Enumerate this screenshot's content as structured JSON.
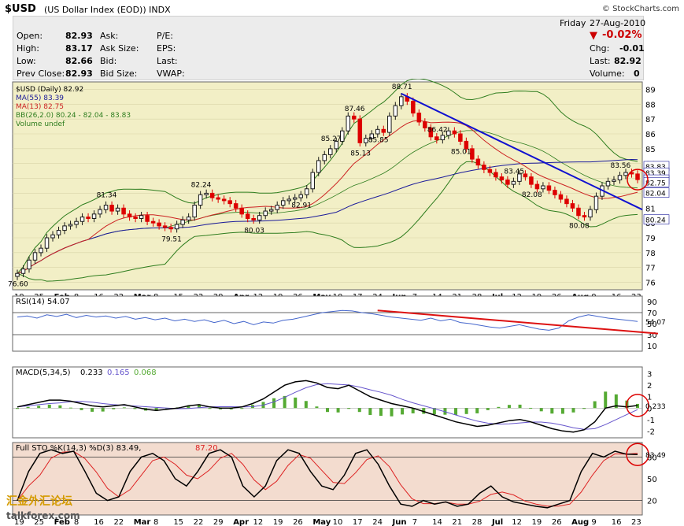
{
  "header": {
    "symbol": "$USD",
    "name": "(US Dollar Index (EOD))",
    "exchange": "INDX",
    "copyright": "© StockCharts.com"
  },
  "quote": {
    "open_label": "Open:",
    "open": "82.93",
    "high_label": "High:",
    "high": "83.17",
    "low_label": "Low:",
    "low": "82.66",
    "prev_label": "Prev Close:",
    "prev": "82.93",
    "ask_label": "Ask:",
    "asksize_label": "Ask Size:",
    "bid_label": "Bid:",
    "bidsize_label": "Bid Size:",
    "pe_label": "P/E:",
    "eps_label": "EPS:",
    "last_label": "Last:",
    "vwap_label": "VWAP:",
    "day": "Friday",
    "date": "27-Aug-2010",
    "pct_change": "-0.02%",
    "chg_label": "Chg:",
    "chg": "-0.01",
    "last2_label": "Last:",
    "last2": "82.92",
    "volume_label": "Volume:",
    "volume": "0"
  },
  "legend": {
    "main": "$USD (Daily) 82.92",
    "ma55": "MA(55) 83.39",
    "ma13": "MA(13) 82.75",
    "bb": "BB(26,2.0) 80.24 - 82.04 - 83.83",
    "volume": "Volume undef",
    "rsi": "RSI(14) 54.07",
    "macd_label": "MACD(5,34,5)",
    "macd_v1": "0.233",
    "macd_v2": "0.165",
    "macd_v3": "0.068",
    "sto_label": "Full STO %K(14,3) %D(3) 83.49,",
    "sto_v2": "87.20"
  },
  "watermark": {
    "cn": "汇金外汇论坛",
    "url": "talkforex.com"
  },
  "colors": {
    "price_bg": "#f2efc6",
    "indicator_bg": "#ffffff",
    "sto_bg": "#f3dccf",
    "up_candle": "#1a1a1a",
    "down_candle": "#dd0000",
    "ma55": "#1a1a9a",
    "ma13": "#cc2222",
    "bb": "#2e7d1e",
    "trend_blue": "#1010d0",
    "trend_red": "#dd1111",
    "rsi_line": "#4466cc",
    "macd_line": "#000000",
    "macd_signal": "#6655cc",
    "macd_hist": "#55aa33",
    "sto_k": "#000000",
    "sto_d": "#dd2222",
    "circle": "#dd0000"
  },
  "chart_data": {
    "type": "line",
    "title": "$USD (US Dollar Index (EOD)) INDX",
    "date_range": [
      "2010-01-19",
      "2010-08-27"
    ],
    "x_tick_labels": [
      "19",
      "25",
      "Feb",
      "8",
      "16",
      "22",
      "Mar",
      "8",
      "15",
      "22",
      "29",
      "Apr",
      "12",
      "19",
      "26",
      "May",
      "10",
      "17",
      "24",
      "Jun",
      "7",
      "14",
      "21",
      "28",
      "Jul",
      "12",
      "19",
      "26",
      "Aug",
      "9",
      "16",
      "23"
    ],
    "y_ticks": [
      76,
      77,
      78,
      79,
      80,
      81,
      82,
      83,
      84,
      85,
      86,
      87,
      88,
      89
    ],
    "ylim": [
      75.5,
      89.5
    ],
    "price_close": [
      76.6,
      76.9,
      77.5,
      78.0,
      78.3,
      79.0,
      79.2,
      79.5,
      79.8,
      79.9,
      80.1,
      80.4,
      80.3,
      80.6,
      80.9,
      81.2,
      80.8,
      81.0,
      80.6,
      80.4,
      80.3,
      80.5,
      80.1,
      80.0,
      79.8,
      79.7,
      79.6,
      79.9,
      80.2,
      80.4,
      81.2,
      81.9,
      82.0,
      81.7,
      81.6,
      81.5,
      81.3,
      81.0,
      80.6,
      80.3,
      80.2,
      80.5,
      80.8,
      80.9,
      81.2,
      81.5,
      81.6,
      81.7,
      81.9,
      82.3,
      83.4,
      84.2,
      84.6,
      85.0,
      85.5,
      86.2,
      87.2,
      87.0,
      85.4,
      85.7,
      86.0,
      86.3,
      86.1,
      87.2,
      87.9,
      88.5,
      88.2,
      87.4,
      86.8,
      86.4,
      85.8,
      85.6,
      85.9,
      86.2,
      86.0,
      85.5,
      85.0,
      84.3,
      83.9,
      83.6,
      83.4,
      83.1,
      82.9,
      82.6,
      82.8,
      83.3,
      83.1,
      82.6,
      82.3,
      82.5,
      82.2,
      81.9,
      81.6,
      81.3,
      81.0,
      80.5,
      80.4,
      80.9,
      81.8,
      82.5,
      82.8,
      82.9,
      83.2,
      83.4,
      83.3,
      82.92
    ],
    "annotations": [
      {
        "label": "76.60",
        "x_index": 0
      },
      {
        "label": "81.34",
        "x_index": 15
      },
      {
        "label": "79.51",
        "x_index": 26
      },
      {
        "label": "82.24",
        "x_index": 31
      },
      {
        "label": "80.03",
        "x_index": 40
      },
      {
        "label": "82.91",
        "x_index": 48
      },
      {
        "label": "85.27",
        "x_index": 53
      },
      {
        "label": "87.46",
        "x_index": 57
      },
      {
        "label": "85.13",
        "x_index": 58
      },
      {
        "label": "85.85",
        "x_index": 61
      },
      {
        "label": "88.71",
        "x_index": 65
      },
      {
        "label": "86.42",
        "x_index": 71
      },
      {
        "label": "85.01",
        "x_index": 75
      },
      {
        "label": "83.45",
        "x_index": 84
      },
      {
        "label": "82.08",
        "x_index": 87
      },
      {
        "label": "80.08",
        "x_index": 95
      },
      {
        "label": "83.56",
        "x_index": 102
      }
    ],
    "right_axis_tags": [
      "83.83",
      "83.39",
      "82.92",
      "82.75",
      "82.04",
      "80.24"
    ],
    "rsi": {
      "ticks": [
        90,
        70,
        50,
        30,
        10
      ],
      "ylim": [
        0,
        100
      ],
      "last": "54.07",
      "values": [
        62,
        64,
        60,
        66,
        63,
        67,
        61,
        65,
        62,
        64,
        60,
        63,
        58,
        61,
        57,
        60,
        55,
        58,
        54,
        57,
        52,
        56,
        50,
        54,
        48,
        53,
        51,
        56,
        58,
        62,
        66,
        70,
        72,
        74,
        73,
        70,
        68,
        65,
        62,
        60,
        58,
        56,
        60,
        55,
        58,
        52,
        50,
        47,
        44,
        42,
        45,
        48,
        44,
        40,
        38,
        42,
        55,
        62,
        66,
        63,
        60,
        58,
        56,
        54.07
      ]
    },
    "macd": {
      "ticks": [
        3,
        2,
        1,
        0,
        -1,
        -2
      ],
      "ylim": [
        -2.6,
        3.6
      ],
      "last": "0.233",
      "values": [
        0.1,
        0.3,
        0.5,
        0.7,
        0.7,
        0.6,
        0.4,
        0.2,
        0.1,
        0.2,
        0.3,
        0.1,
        -0.1,
        -0.2,
        -0.1,
        0.0,
        0.2,
        0.3,
        0.1,
        0.0,
        0.0,
        0.1,
        0.4,
        0.8,
        1.4,
        2.0,
        2.3,
        2.4,
        2.2,
        1.8,
        1.7,
        2.0,
        1.5,
        1.0,
        0.7,
        0.4,
        0.2,
        0.0,
        -0.3,
        -0.6,
        -0.9,
        -1.2,
        -1.4,
        -1.6,
        -1.5,
        -1.3,
        -1.1,
        -1.0,
        -1.2,
        -1.5,
        -1.8,
        -2.0,
        -2.1,
        -1.9,
        -1.2,
        0.0,
        0.2,
        0.1,
        0.233
      ]
    },
    "sto": {
      "ticks": [
        80,
        50,
        20
      ],
      "ylim": [
        0,
        100
      ],
      "last": "83.49",
      "values": [
        20,
        60,
        85,
        90,
        85,
        88,
        60,
        30,
        20,
        25,
        60,
        80,
        85,
        75,
        50,
        40,
        60,
        85,
        90,
        80,
        40,
        25,
        40,
        75,
        90,
        85,
        60,
        40,
        35,
        55,
        85,
        90,
        70,
        40,
        15,
        12,
        20,
        15,
        18,
        12,
        15,
        30,
        40,
        25,
        18,
        15,
        12,
        10,
        15,
        20,
        60,
        85,
        80,
        88,
        84,
        83.49
      ]
    }
  }
}
